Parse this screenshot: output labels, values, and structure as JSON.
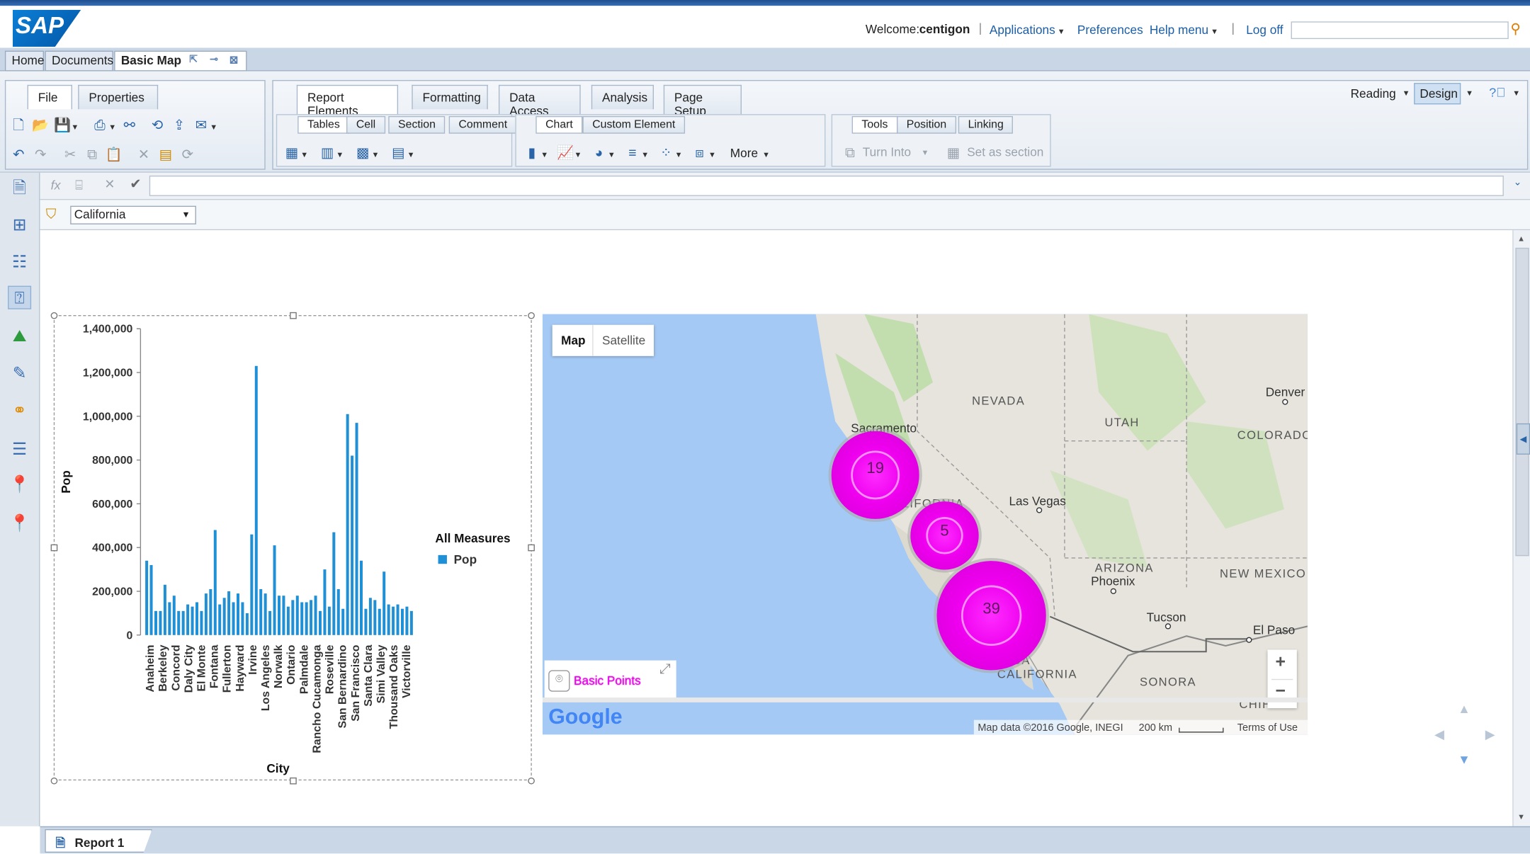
{
  "header": {
    "brand": "SAP",
    "welcome_label": "Welcome:",
    "user": "centigon",
    "applications": "Applications",
    "preferences": "Preferences",
    "help_menu": "Help menu",
    "separator": "|",
    "log_off": "Log off",
    "search_value": ""
  },
  "doc_tabs": [
    "Home",
    "Documents",
    "Basic Map"
  ],
  "left_panel": {
    "tabs": [
      "File",
      "Properties"
    ],
    "active_tab": "File"
  },
  "ribbon": {
    "tabs": [
      "Report Elements",
      "Formatting",
      "Data Access",
      "Analysis",
      "Page Setup"
    ],
    "active_tab": "Report Elements",
    "group1_tabs": [
      "Tables",
      "Cell",
      "Section",
      "Comment"
    ],
    "group2_tabs": [
      "Chart",
      "Custom Element"
    ],
    "group3_tabs": [
      "Tools",
      "Position",
      "Linking"
    ],
    "more_label": "More",
    "turn_into_label": "Turn Into",
    "set_as_section_label": "Set as section"
  },
  "mode": {
    "reading": "Reading",
    "design": "Design",
    "active": "Design"
  },
  "formula": {
    "value": ""
  },
  "filter": {
    "value": "California"
  },
  "chart_data": {
    "type": "bar",
    "xlabel": "City",
    "ylabel": "Pop",
    "ylim": [
      0,
      1400000
    ],
    "yticks": [
      "0",
      "200,000",
      "400,000",
      "600,000",
      "800,000",
      "1,000,000",
      "1,200,000",
      "1,400,000"
    ],
    "legend_title": "All Measures",
    "legend_position": "right",
    "series": [
      {
        "name": "Pop",
        "color": "#1f8fd6",
        "values": [
          340000,
          320000,
          110000,
          110000,
          230000,
          150000,
          180000,
          110000,
          110000,
          140000,
          130000,
          150000,
          110000,
          190000,
          210000,
          480000,
          140000,
          170000,
          200000,
          150000,
          190000,
          150000,
          100000,
          460000,
          1230000,
          210000,
          190000,
          110000,
          410000,
          180000,
          180000,
          130000,
          160000,
          180000,
          150000,
          150000,
          160000,
          180000,
          110000,
          300000,
          130000,
          470000,
          210000,
          120000,
          1010000,
          820000,
          970000,
          340000,
          120000,
          170000,
          160000,
          120000,
          290000,
          140000,
          130000,
          140000,
          120000,
          130000,
          110000
        ]
      }
    ],
    "category_labels": [
      "Anaheim",
      "Berkeley",
      "Concord",
      "Daly City",
      "El Monte",
      "Fontana",
      "Fullerton",
      "Hayward",
      "Irvine",
      "Los Angeles",
      "Norwalk",
      "Ontario",
      "Palmdale",
      "Rancho Cucamonga",
      "Roseville",
      "San Bernardino",
      "San Francisco",
      "Santa Clara",
      "Simi Valley",
      "Thousand Oaks",
      "Victorville"
    ]
  },
  "map": {
    "buttons": [
      "Map",
      "Satellite"
    ],
    "active": "Map",
    "states": [
      "NEVADA",
      "UTAH",
      "COLORADO",
      "CALIFORNIA",
      "ARIZONA",
      "NEW MEXICO",
      "BAJA CALIFORNIA",
      "SONORA",
      "CHIHU"
    ],
    "cities": [
      "Sacramento",
      "Denver",
      "Las Vegas",
      "Phoenix",
      "Tucson",
      "El Paso"
    ],
    "clusters": [
      "19",
      "5",
      "39"
    ],
    "layer_label": "Basic Points",
    "attribution": "Map data ©2016 Google, INEGI",
    "scale": "200 km",
    "terms": "Terms of Use",
    "logo": "Google",
    "zoom_in": "+",
    "zoom_out": "−"
  },
  "report_tab": "Report 1"
}
